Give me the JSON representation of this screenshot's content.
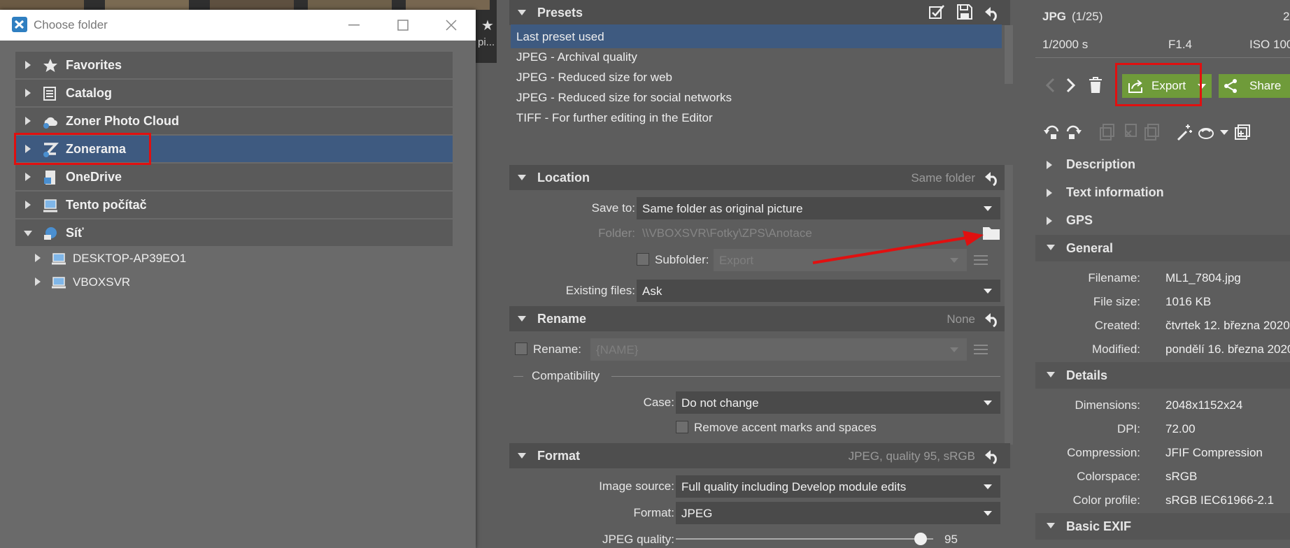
{
  "dialog": {
    "title": "Choose folder",
    "tree": [
      {
        "label": "Favorites",
        "icon": "star-icon"
      },
      {
        "label": "Catalog",
        "icon": "catalog-icon"
      },
      {
        "label": "Zoner Photo Cloud",
        "icon": "cloud-icon"
      },
      {
        "label": "Zonerama",
        "icon": "zonerama-icon"
      },
      {
        "label": "OneDrive",
        "icon": "onedrive-icon"
      },
      {
        "label": "Tento počítač",
        "icon": "computer-icon"
      },
      {
        "label": "Síť",
        "icon": "network-icon"
      }
    ],
    "network_children": [
      {
        "label": "DESKTOP-AP39EO1",
        "icon": "computer-icon"
      },
      {
        "label": "VBOXSVR",
        "icon": "computer-icon"
      }
    ]
  },
  "strip": {
    "star": "★",
    "text": "pi..."
  },
  "presets": {
    "title": "Presets",
    "items": [
      "Last preset used",
      "JPEG - Archival quality",
      "JPEG - Reduced size for web",
      "JPEG - Reduced size for social networks",
      "TIFF - For further editing in the Editor"
    ]
  },
  "location": {
    "title": "Location",
    "value": "Same folder",
    "save_to_label": "Save to:",
    "save_to_value": "Same folder as original picture",
    "folder_label": "Folder:",
    "folder_value": "\\\\VBOXSVR\\Fotky\\ZPS\\Anotace",
    "subfolder_label": "Subfolder:",
    "subfolder_value": "Export",
    "existing_label": "Existing files:",
    "existing_value": "Ask"
  },
  "rename": {
    "title": "Rename",
    "value": "None",
    "rename_label": "Rename:",
    "rename_value": "{NAME}",
    "compat_label": "Compatibility",
    "case_label": "Case:",
    "case_value": "Do not change",
    "accent_label": "Remove accent marks and spaces"
  },
  "format": {
    "title": "Format",
    "value": "JPEG, quality 95, sRGB",
    "source_label": "Image source:",
    "source_value": "Full quality including Develop module edits",
    "format_label": "Format:",
    "format_value": "JPEG",
    "quality_label": "JPEG quality:",
    "quality_value": "95",
    "quality_fraction": 0.95
  },
  "info": {
    "type": "JPG",
    "index": "(1/25)",
    "corner": "2",
    "shutter": "1/2000 s",
    "aperture": "F1.4",
    "iso": "ISO 100",
    "export_label": "Export",
    "share_label": "Share",
    "sections": [
      "Description",
      "Text information",
      "GPS",
      "General",
      "Details",
      "Basic EXIF"
    ],
    "general": [
      {
        "k": "Filename:",
        "v": "ML1_7804.jpg"
      },
      {
        "k": "File size:",
        "v": "1016 KB"
      },
      {
        "k": "Created:",
        "v": "čtvrtek 12. března 2020"
      },
      {
        "k": "Modified:",
        "v": "pondělí 16. března 2020"
      }
    ],
    "details": [
      {
        "k": "Dimensions:",
        "v": "2048x1152x24"
      },
      {
        "k": "DPI:",
        "v": "72.00"
      },
      {
        "k": "Compression:",
        "v": "JFIF Compression"
      },
      {
        "k": "Colorspace:",
        "v": "sRGB"
      },
      {
        "k": "Color profile:",
        "v": "sRGB IEC61966-2.1"
      }
    ]
  },
  "colors": {
    "accent_selection": "#3e5a80",
    "export_green": "#6f9b3a",
    "annotation_red": "#e01010"
  }
}
